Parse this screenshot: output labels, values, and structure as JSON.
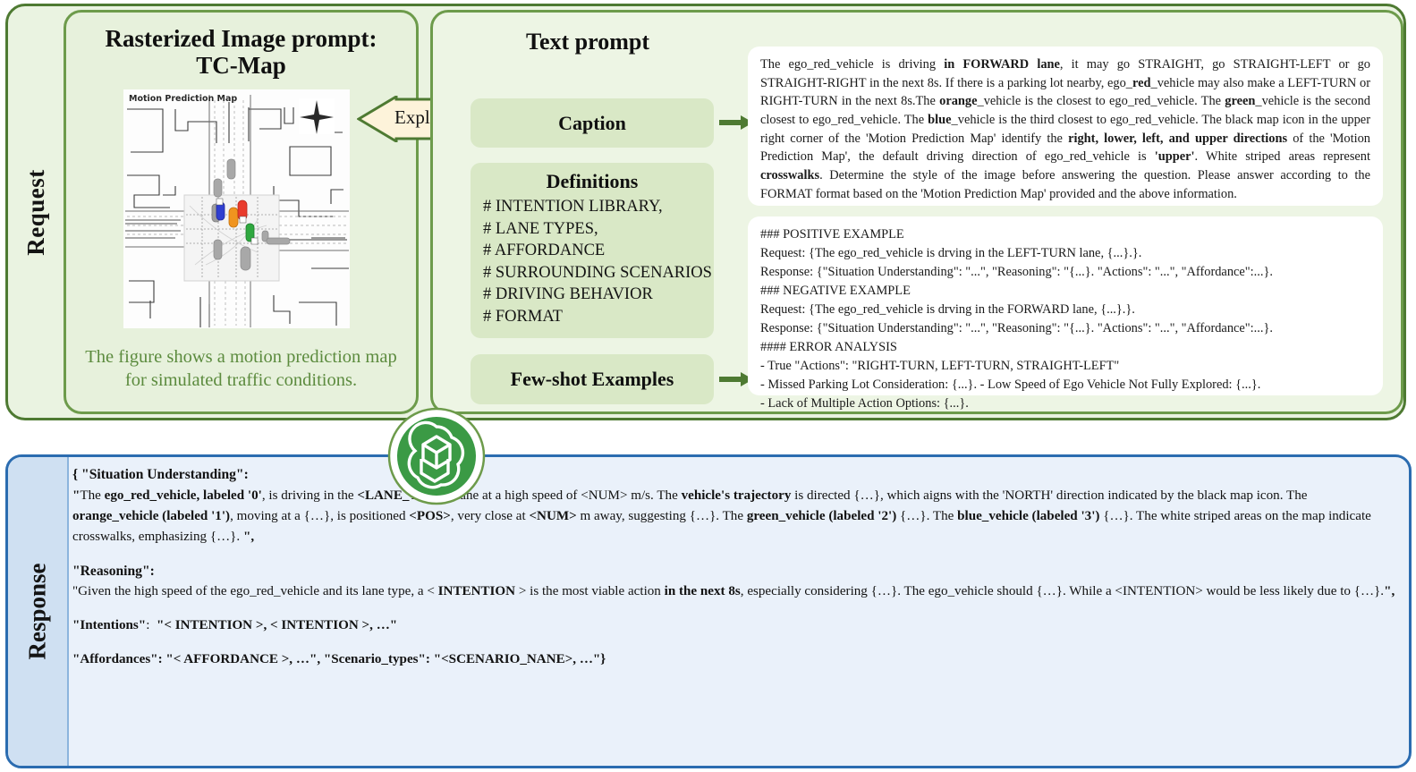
{
  "request": {
    "side_label": "Request",
    "image_prompt": {
      "title_line1": "Rasterized Image prompt:",
      "title_line2": "TC-Map",
      "map_title": "Motion Prediction Map",
      "caption": "The figure shows a motion prediction map for simulated traffic conditions."
    },
    "explain_arrow_label": "Explain",
    "text_prompt": {
      "title": "Text prompt",
      "caption_chip": "Caption",
      "definitions_title": "Definitions",
      "definitions_items": [
        "# INTENTION LIBRARY,",
        "# LANE TYPES,",
        "# AFFORDANCE",
        "# SURROUNDING SCENARIOS",
        "# DRIVING BEHAVIOR",
        "# FORMAT"
      ],
      "fewshot_chip": "Few-shot Examples",
      "caption_text_html": "The ego_red_vehicle is driving <b>in FORWARD lane</b>, it may go STRAIGHT, go STRAIGHT-LEFT or go STRAIGHT-RIGHT in the next 8s. If there is a parking lot nearby, ego_<b>red</b>_vehicle may also make a LEFT-TURN or RIGHT-TURN in the next 8s.The <b>orange</b>_vehicle is the closest to ego_red_vehicle. The <b>green</b>_vehicle is the second closest to ego_red_vehicle. The <b>blue</b>_vehicle is the third closest to ego_red_vehicle. The black map icon in the upper right corner of the 'Motion Prediction Map' identify the <b>right, lower, left, and upper directions</b> of the 'Motion Prediction Map', the default driving direction of ego_red_vehicle is <b>'upper'</b>. White striped areas represent <b>crosswalks</b>. Determine the style of the image before answering the question. Please answer according to the FORMAT format based on the 'Motion Prediction Map' provided and the above information.",
      "examples_lines": [
        "### POSITIVE EXAMPLE",
        "Request: {The ego_red_vehicle is drving in the LEFT-TURN lane, {...}.}.",
        "Response: {\"Situation Understanding\": \"...\", \"Reasoning\": \"{...}. \"Actions\": \"...\", \"Affordance\":...}.",
        "### NEGATIVE EXAMPLE",
        "Request: {The ego_red_vehicle is drving in the FORWARD lane, {...}.}.",
        "Response: {\"Situation Understanding\": \"...\", \"Reasoning\": \"{...}. \"Actions\": \"...\", \"Affordance\":...}.",
        "#### ERROR ANALYSIS",
        "- True \"Actions\": \"RIGHT-TURN, LEFT-TURN, STRAIGHT-LEFT\"",
        "- Missed Parking Lot Consideration: {...}. - Low Speed of Ego Vehicle Not Fully Explored: {...}.",
        "- Lack of Multiple Action Options: {...}."
      ]
    }
  },
  "model_logo": "openai-logo",
  "response": {
    "side_label": "Response",
    "situation_head_html": "{ <b>\"Situation Understanding\"</b>:",
    "situation_body_html": "<b>\"</b>The <b>ego_red_vehicle, labeled '0'</b>, is driving in the <b>&lt;LANE_TYPE&gt;</b> lane at a high speed of &lt;NUM&gt; m/s. The <b>vehicle's trajectory</b> is directed {…}, which aigns with the 'NORTH' direction indicated by the black map icon. The <b>orange_vehicle (labeled '1')</b>, moving at a {…}, is positioned <b>&lt;POS&gt;</b>, very close at <b>&lt;NUM&gt;</b> m away, suggesting {…}. The <b>green_vehicle (labeled '2')</b> {…}. The <b>blue_vehicle (labeled '3')</b> {…}. The white striped areas on the map indicate crosswalks, emphasizing {…}. <b>\",</b>",
    "reasoning_head_html": "<b>\"Reasoning\"</b>:",
    "reasoning_body_html": "\"Given the high speed of the ego_red_vehicle and its lane type, a &lt; <b>INTENTION</b> &gt; is the most viable action <b>in the next 8s</b>, especially considering {…}. The ego_vehicle should {…}. While a &lt;INTENTION&gt; would be less likely due to {…}.<b>\",</b>",
    "intentions_html": "<b>\"Intentions\"</b>:&nbsp; <b>\"&lt; INTENTION &gt;, &lt; INTENTION &gt;, …\"</b>",
    "affordances_html": "<b>\"Affordances\": \"&lt; AFFORDANCE &gt;, …\", \"Scenario_types\": \"&lt;SCENARIO_NANE&gt;, …\"}</b>"
  },
  "colors": {
    "request_border": "#4e7a32",
    "request_bg": "#eaf3e1",
    "card_border": "#6d9b4b",
    "chip_bg": "#d9e8c6",
    "response_border": "#2b6cb0",
    "response_bg": "#eaf1fa",
    "response_label_bg": "#cfe0f2",
    "caption_text": "#5c8b3e",
    "explain_fill": "#fdf3da",
    "logo_green": "#3b9a45"
  }
}
